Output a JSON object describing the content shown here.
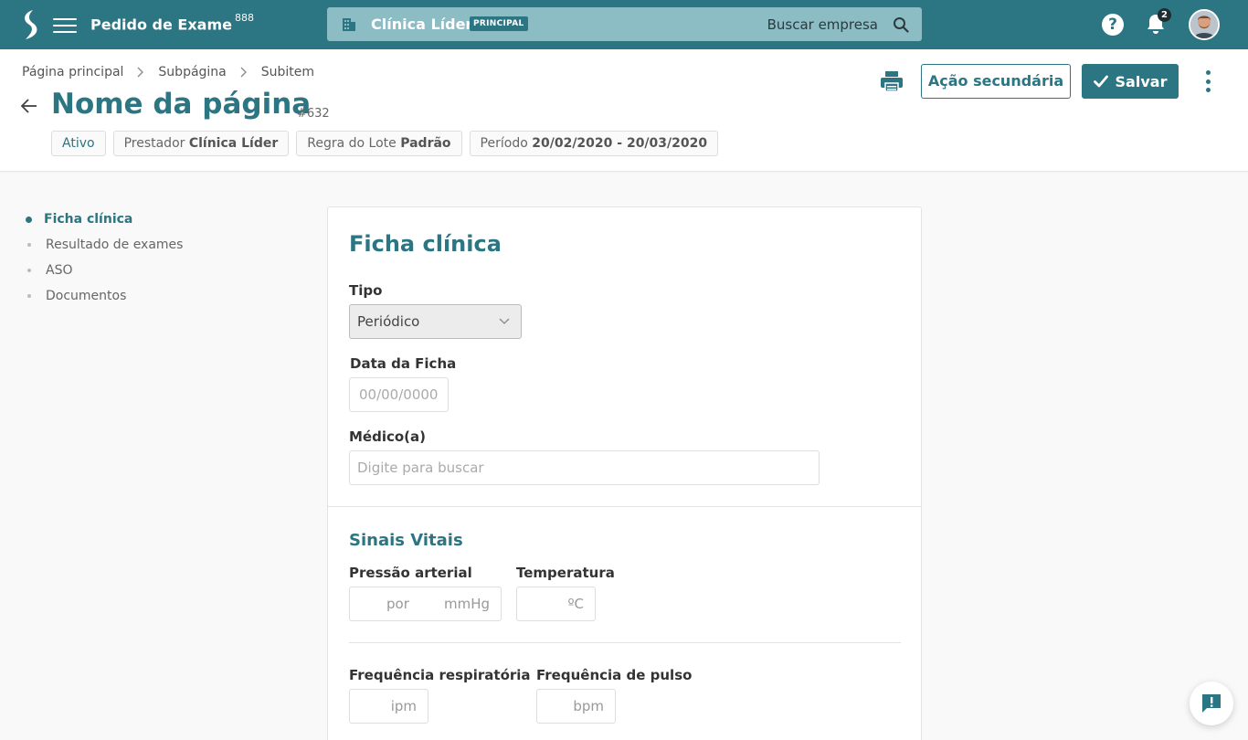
{
  "topbar": {
    "app_title": "Pedido de Exame",
    "app_title_sup": "888",
    "company_name": "Clínica Líder",
    "company_badge": "PRINCIPAL",
    "company_search_label": "Buscar empresa",
    "help_label": "?",
    "notification_count": "2",
    "brand_color": "#2c7582"
  },
  "breadcrumb": [
    "Página principal",
    "Subpágina",
    "Subitem"
  ],
  "header": {
    "title": "Nome da página",
    "id": "#632",
    "tags": {
      "status": "Ativo",
      "prestador_label": "Prestador",
      "prestador_value": "Clínica Líder",
      "regra_label": "Regra do Lote",
      "regra_value": "Padrão",
      "periodo_label": "Período",
      "periodo_value": "20/02/2020 - 20/03/2020"
    },
    "secondary_action": "Ação secundária",
    "save_label": "Salvar"
  },
  "side_nav": [
    {
      "label": "Ficha clínica",
      "active": true
    },
    {
      "label": "Resultado de exames",
      "active": false
    },
    {
      "label": "ASO",
      "active": false
    },
    {
      "label": "Documentos",
      "active": false
    }
  ],
  "form": {
    "title": "Ficha clínica",
    "tipo_label": "Tipo",
    "tipo_value": "Periódico",
    "data_label": "Data da Ficha",
    "data_placeholder": "00/00/0000",
    "medico_label": "Médico(a)",
    "medico_placeholder": "Digite para buscar"
  },
  "vitals": {
    "title": "Sinais Vitais",
    "pressao_label": "Pressão arterial",
    "pressao_sep": "por",
    "pressao_unit": "mmHg",
    "temperatura_label": "Temperatura",
    "temperatura_unit": "ºC",
    "freq_resp_label": "Frequência respiratória",
    "freq_resp_unit": "ipm",
    "freq_pulso_label": "Frequência de pulso",
    "freq_pulso_unit": "bpm"
  }
}
